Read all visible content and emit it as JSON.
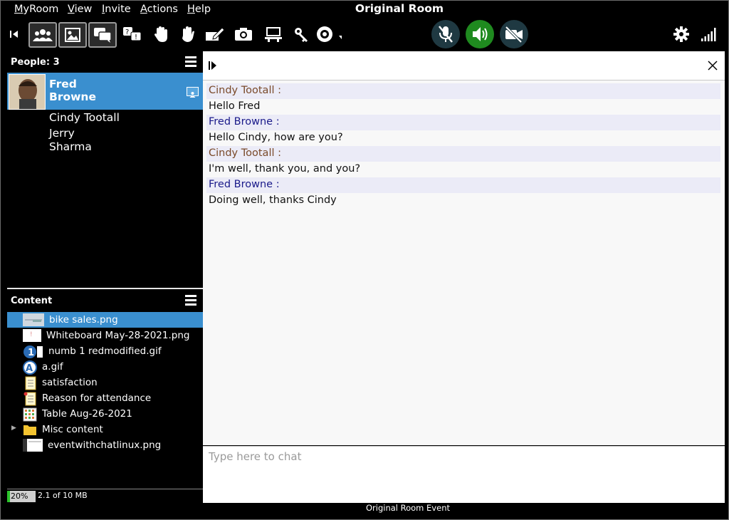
{
  "menubar": {
    "items": [
      {
        "first": "M",
        "rest": "yRoom"
      },
      {
        "first": "V",
        "rest": "iew"
      },
      {
        "first": "I",
        "rest": "nvite"
      },
      {
        "first": "A",
        "rest": "ctions"
      },
      {
        "first": "H",
        "rest": "elp"
      }
    ],
    "window_title": "Original Room"
  },
  "toolbar": {
    "icons": [
      "collapse-left-icon",
      "people-view-icon",
      "image-view-icon",
      "chat-view-icon",
      "question-icon",
      "raise-hand-icon",
      "wave-icon",
      "whiteboard-icon",
      "camera-icon",
      "webtour-icon",
      "key-icon",
      "emoji-status-icon",
      "settings-icon",
      "signal-icon"
    ],
    "colors": {
      "mic": "#1f3942",
      "speaker": "#1f8a1f",
      "video": "#1f3942"
    }
  },
  "people": {
    "header": "People: 3",
    "selected": {
      "first": "Fred",
      "last": "Browne"
    },
    "others": [
      "Cindy Tootall",
      "Jerry",
      "Sharma"
    ]
  },
  "content": {
    "header": "Content",
    "items": [
      {
        "label": "bike sales.png",
        "icon": "image-thumb-icon"
      },
      {
        "label": "Whiteboard May-28-2021.png",
        "icon": "whiteboard-thumb-icon"
      },
      {
        "label": "numb 1 redmodified.gif",
        "icon": "number-one-icon"
      },
      {
        "label": "a.gif",
        "icon": "letter-a-icon"
      },
      {
        "label": "satisfaction",
        "icon": "survey-icon"
      },
      {
        "label": "Reason for attendance",
        "icon": "survey-icon"
      },
      {
        "label": "Table Aug-26-2021",
        "icon": "table-icon"
      },
      {
        "label": "Misc content",
        "icon": "folder-icon"
      },
      {
        "label": "eventwithchatlinux.png",
        "icon": "image-thumb-icon"
      }
    ],
    "storage_percent": "20%",
    "storage_fraction": 0.2,
    "storage_text": "2.1 of 10 MB"
  },
  "chat": {
    "messages": [
      {
        "sender": "Cindy Tootall :",
        "text": "Hello Fred",
        "color": "#7a4a2a"
      },
      {
        "sender": "Fred Browne :",
        "text": "Hello Cindy, how are you?",
        "color": "#1a1a8a"
      },
      {
        "sender": "Cindy Tootall :",
        "text": "I'm well, thank you, and you?",
        "color": "#7a4a2a"
      },
      {
        "sender": "Fred Browne :",
        "text": "Doing well, thanks Cindy",
        "color": "#1a1a8a"
      }
    ],
    "placeholder": "Type here to chat"
  },
  "footer": {
    "event": "Original Room Event"
  }
}
